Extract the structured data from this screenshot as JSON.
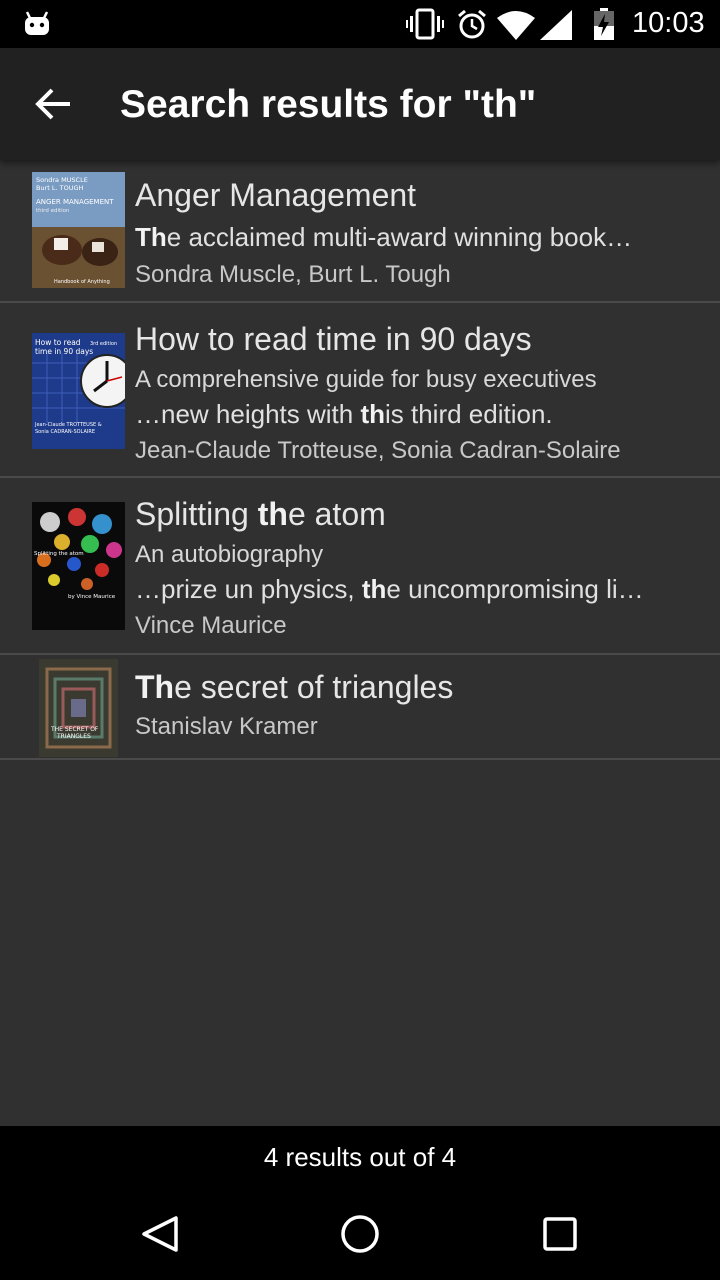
{
  "status_bar": {
    "time": "10:03"
  },
  "app_bar": {
    "title": "Search results for \"th\""
  },
  "results": [
    {
      "title": {
        "pre": "",
        "hl": "",
        "post": "Anger Management"
      },
      "lines": [
        {
          "pre": "",
          "hl": "Th",
          "post": "e acclaimed multi-award winning book…"
        }
      ],
      "authors": "Sondra Muscle, Burt L. Tough",
      "cover": {
        "name": "anger-management-cover",
        "line1": "Sondra MUSCLE",
        "line2": "Burt L. TOUGH",
        "line3": "ANGER MANAGEMENT",
        "line4": "third edition",
        "line5": "Handbook of Anything"
      }
    },
    {
      "title": {
        "pre": "How to read time in 90 days",
        "hl": "",
        "post": ""
      },
      "lines": [
        {
          "pre": "A comprehensive guide for busy executives",
          "hl": "",
          "post": ""
        },
        {
          "pre": " …new heights with ",
          "hl": "th",
          "post": "is third edition."
        }
      ],
      "authors": "Jean-Claude Trotteuse, Sonia Cadran-Solaire",
      "cover": {
        "name": "how-to-read-time-cover",
        "line1": "How to read",
        "line2": "time in 90 days",
        "line3": "Jean-Claude TROTTEUSE &",
        "line4": "Sonia CADRAN-SOLAIRE",
        "line5": "3rd edition"
      }
    },
    {
      "title": {
        "pre": "Splitting ",
        "hl": "th",
        "post": "e atom"
      },
      "lines": [
        {
          "pre": "An autobiography",
          "hl": "",
          "post": ""
        },
        {
          "pre": " …prize un physics, ",
          "hl": "th",
          "post": "e uncompromising li…"
        }
      ],
      "authors": "Vince Maurice",
      "cover": {
        "name": "splitting-the-atom-cover",
        "line1": "Splitting the atom",
        "line2": "by Vince Maurice"
      }
    },
    {
      "title": {
        "pre": "",
        "hl": "Th",
        "post": "e secret of triangles"
      },
      "lines": [],
      "authors": "Stanislav Kramer",
      "cover": {
        "name": "secret-of-triangles-cover",
        "line1": "THE SECRET OF",
        "line2": "TRIANGLES"
      }
    }
  ],
  "footer": {
    "count_text": "4 results out of 4"
  },
  "colors": {
    "background": "#303030",
    "app_bar": "#212121",
    "status_bar": "#000000",
    "divider": "#4a4a4a"
  }
}
